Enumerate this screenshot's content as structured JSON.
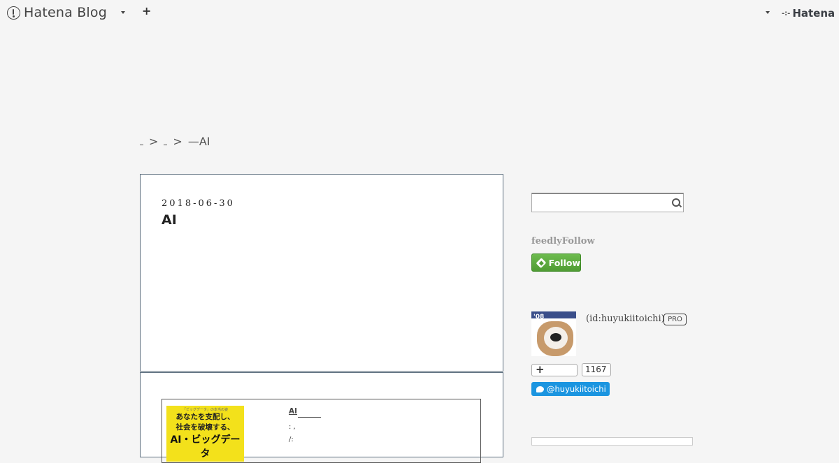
{
  "topbar": {
    "logo_text": "Hatena Blog",
    "add_label": "+",
    "brand": "Hatena",
    "brand_mark": "-:-"
  },
  "breadcrumb": {
    "sep1": ">",
    "sep2": ">",
    "current": "—AI"
  },
  "article": {
    "date": "2018-06-30",
    "title": "AI"
  },
  "embed": {
    "book_small": "「ビッグデータ」の本当の姿",
    "book_line1": "あなたを支配し、",
    "book_line2": "社会を破壊する、",
    "book_line3": "AI・ビッグデータ",
    "title": "AI",
    "meta1": ":   ,",
    "meta2": "/:"
  },
  "sidebar": {
    "search_placeholder": "",
    "feedly_title": "feedlyFollow",
    "feedly_button": "Follow",
    "avatar_year": "'08",
    "profile_id": "(id:huyukiitoichi)",
    "pro_badge": "PRO",
    "subscribe_plus": "+",
    "subscriber_count": "1167",
    "twitter_handle": "@huyukiitoichi"
  },
  "icons": [
    "hatena-logo-icon",
    "chevron-down-icon",
    "plus-icon",
    "search-icon",
    "feedly-icon",
    "twitter-bird-icon"
  ]
}
